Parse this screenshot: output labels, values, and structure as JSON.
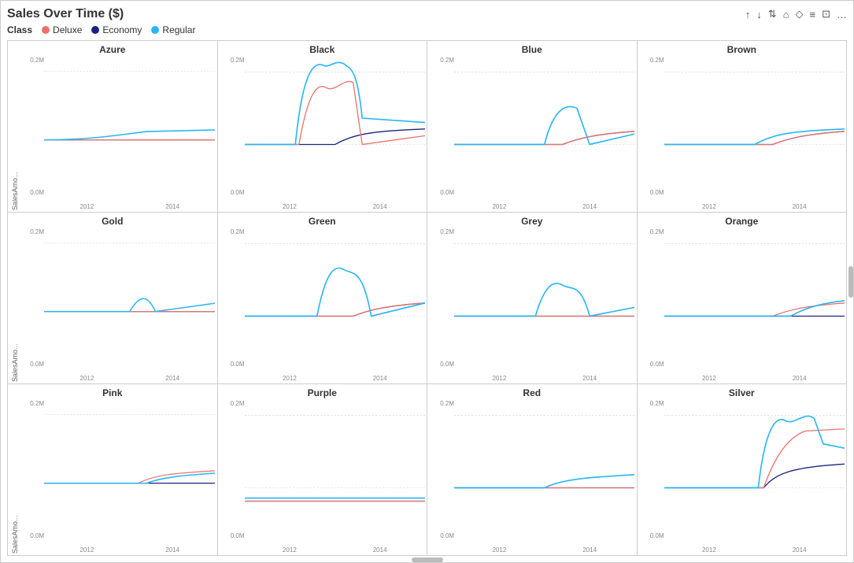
{
  "title": "Sales Over Time ($)",
  "legend": {
    "class_label": "Class",
    "items": [
      {
        "name": "Deluxe",
        "color": "#e8736b"
      },
      {
        "name": "Economy",
        "color": "#1a237e"
      },
      {
        "name": "Regular",
        "color": "#29b6f6"
      }
    ]
  },
  "toolbar": {
    "icons": [
      "↑",
      "↓",
      "↓↑",
      "⌂",
      "◇",
      "≡",
      "⊡",
      "…"
    ]
  },
  "y_axis_label": "SalesAmo...",
  "y_ticks": [
    "0.2M",
    "0.0M"
  ],
  "x_ticks": [
    "2012",
    "2014"
  ],
  "cells": [
    {
      "name": "Azure",
      "col": 0,
      "row": 0,
      "lines": {
        "deluxe": "flat_low",
        "economy": "flat_low",
        "regular": "flat_low_slight"
      }
    },
    {
      "name": "Black",
      "col": 1,
      "row": 0,
      "lines": {
        "deluxe": "mid_peaks",
        "economy": "low_mid",
        "regular": "high_peaks"
      }
    },
    {
      "name": "Blue",
      "col": 2,
      "row": 0,
      "lines": {
        "deluxe": "low_slight",
        "economy": "low_slight",
        "regular": "low_mid_peaks"
      }
    },
    {
      "name": "Brown",
      "col": 3,
      "row": 0,
      "lines": {
        "deluxe": "low_slight",
        "economy": "low_slight",
        "regular": "low_mid"
      }
    },
    {
      "name": "Gold",
      "col": 0,
      "row": 1,
      "lines": {
        "deluxe": "flat_low",
        "economy": "flat_low",
        "regular": "flat_low_bump"
      }
    },
    {
      "name": "Green",
      "col": 1,
      "row": 1,
      "lines": {
        "deluxe": "low_slight",
        "economy": "low_slight",
        "regular": "low_peaks"
      }
    },
    {
      "name": "Grey",
      "col": 2,
      "row": 1,
      "lines": {
        "deluxe": "flat_low",
        "economy": "flat_low",
        "regular": "low_mid_peaks2"
      }
    },
    {
      "name": "Orange",
      "col": 3,
      "row": 1,
      "lines": {
        "deluxe": "low_slight",
        "economy": "flat_low",
        "regular": "low_mid_end"
      }
    },
    {
      "name": "Pink",
      "col": 0,
      "row": 2,
      "lines": {
        "deluxe": "low_slight2",
        "economy": "flat_low",
        "regular": "flat_slight"
      }
    },
    {
      "name": "Purple",
      "col": 1,
      "row": 2,
      "lines": {
        "deluxe": "flat_zero",
        "economy": "flat_zero",
        "regular": "flat_low_line"
      }
    },
    {
      "name": "Red",
      "col": 2,
      "row": 2,
      "lines": {
        "deluxe": "flat_low",
        "economy": "flat_low",
        "regular": "low_slight3"
      }
    },
    {
      "name": "Silver",
      "col": 3,
      "row": 2,
      "lines": {
        "deluxe": "mid_rise",
        "economy": "low_mid2",
        "regular": "high_peaks2"
      }
    }
  ]
}
